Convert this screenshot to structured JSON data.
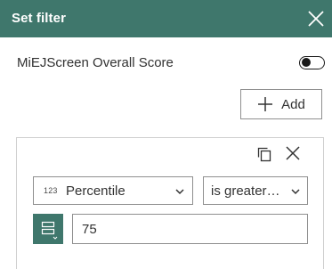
{
  "panel": {
    "title": "Set filter",
    "close_icon": "close-icon",
    "header_color": "#3f776c"
  },
  "toggle": {
    "label": "MiEJScreen Overall Score",
    "checked": false
  },
  "add_button": {
    "label": "Add",
    "icon": "plus-icon"
  },
  "filter": {
    "field": {
      "type_badge": "123",
      "value": "Percentile"
    },
    "operator": {
      "value": "is greater…"
    },
    "value_input": {
      "value": "75"
    },
    "icons": {
      "copy": "copy-icon",
      "remove": "close-icon",
      "mode": "value-input-mode-icon"
    }
  }
}
